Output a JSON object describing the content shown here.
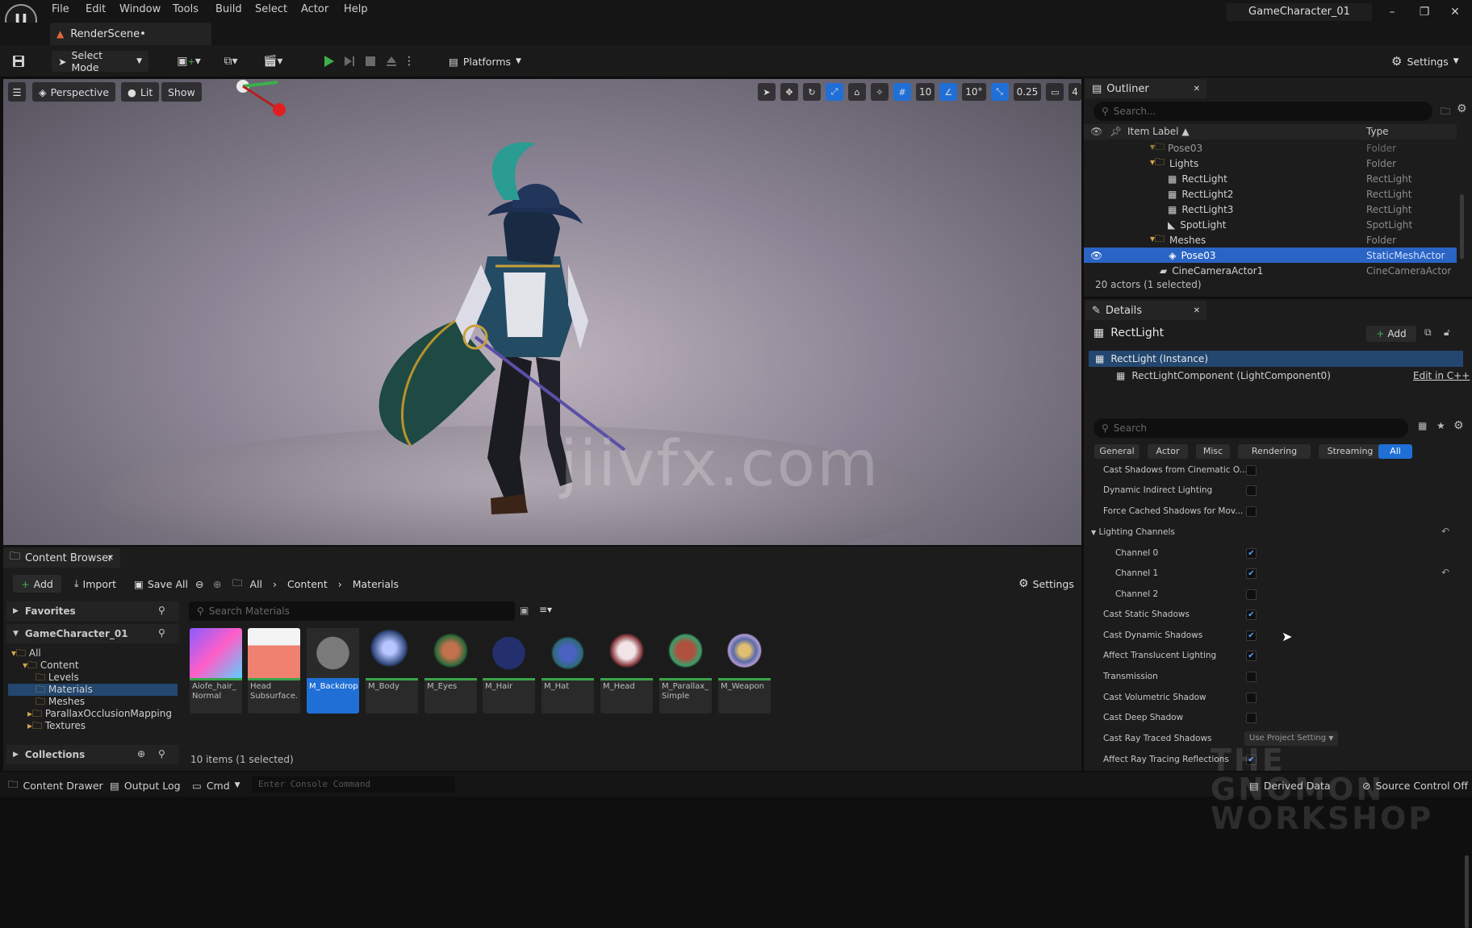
{
  "menubar": {
    "items": [
      "File",
      "Edit",
      "Window",
      "Tools",
      "Build",
      "Select",
      "Actor",
      "Help"
    ],
    "project_name": "GameCharacter_01"
  },
  "doc_tab": {
    "label": "RenderScene•"
  },
  "toolbar": {
    "select_mode": "Select Mode",
    "platforms": "Platforms",
    "settings": "Settings"
  },
  "viewport": {
    "perspective": "Perspective",
    "lit": "Lit",
    "show": "Show",
    "grid_size": "10",
    "rotation_snap": "10°",
    "scale_snap": "0.25",
    "camera_speed": "4",
    "watermark": "jiivfx.com"
  },
  "outliner": {
    "tab": "Outliner",
    "search_placeholder": "Search...",
    "col_label": "Item Label ▲",
    "col_type": "Type",
    "rows": [
      {
        "label": "Pose03",
        "type": "Folder"
      },
      {
        "label": "Lights",
        "type": "Folder"
      },
      {
        "label": "RectLight",
        "type": "RectLight"
      },
      {
        "label": "RectLight2",
        "type": "RectLight"
      },
      {
        "label": "RectLight3",
        "type": "RectLight"
      },
      {
        "label": "SpotLight",
        "type": "SpotLight"
      },
      {
        "label": "Meshes",
        "type": "Folder"
      },
      {
        "label": "Pose03",
        "type": "StaticMeshActor"
      },
      {
        "label": "CineCameraActor1",
        "type": "CineCameraActor"
      }
    ],
    "status": "20 actors (1 selected)"
  },
  "details": {
    "tab": "Details",
    "actor": "RectLight",
    "add": "Add",
    "instance": "RectLight (Instance)",
    "component": "RectLightComponent (LightComponent0)",
    "edit_cpp": "Edit in C++",
    "search_placeholder": "Search",
    "tabs": [
      "General",
      "Actor",
      "Misc",
      "Rendering",
      "Streaming",
      "All"
    ],
    "props": [
      {
        "label": "Cast Shadows from Cinematic O...",
        "checked": false
      },
      {
        "label": "Dynamic Indirect Lighting",
        "checked": false
      },
      {
        "label": "Force Cached Shadows for Mov...",
        "checked": false
      },
      {
        "label": "Lighting Channels",
        "section": true
      },
      {
        "label": "Channel 0",
        "checked": true
      },
      {
        "label": "Channel 1",
        "checked": true
      },
      {
        "label": "Channel 2",
        "checked": false
      },
      {
        "label": "Cast Static Shadows",
        "checked": true
      },
      {
        "label": "Cast Dynamic Shadows",
        "checked": true
      },
      {
        "label": "Affect Translucent Lighting",
        "checked": true
      },
      {
        "label": "Transmission",
        "checked": false
      },
      {
        "label": "Cast Volumetric Shadow",
        "checked": false
      },
      {
        "label": "Cast Deep Shadow",
        "checked": false
      },
      {
        "label": "Cast Ray Traced Shadows",
        "dropdown": "Use Project Setting"
      },
      {
        "label": "Affect Ray Tracing Reflections",
        "checked": true
      }
    ]
  },
  "content_browser": {
    "tab": "Content Browser",
    "add": "Add",
    "import": "Import",
    "save_all": "Save All",
    "breadcrumb": [
      "All",
      "Content",
      "Materials"
    ],
    "settings": "Settings",
    "favorites": "Favorites",
    "root": "GameCharacter_01",
    "tree": [
      "All",
      "Content",
      "Levels",
      "Materials",
      "Meshes",
      "ParallaxOcclusionMapping",
      "Textures"
    ],
    "collections": "Collections",
    "search_placeholder": "Search Materials",
    "assets": [
      {
        "label": "Aiofe_hair_ Normal"
      },
      {
        "label": "Head Subsurface..."
      },
      {
        "label": "M_Backdrop"
      },
      {
        "label": "M_Body"
      },
      {
        "label": "M_Eyes"
      },
      {
        "label": "M_Hair"
      },
      {
        "label": "M_Hat"
      },
      {
        "label": "M_Head"
      },
      {
        "label": "M_Parallax_ Simple"
      },
      {
        "label": "M_Weapon"
      }
    ],
    "item_count": "10 items (1 selected)"
  },
  "statusbar": {
    "content_drawer": "Content Drawer",
    "output_log": "Output Log",
    "cmd": "Cmd",
    "console_placeholder": "Enter Console Command",
    "derived_data": "Derived Data",
    "source_control": "Source Control Off",
    "gnomon": "THE GNOMON WORKSHOP"
  },
  "colors": {
    "accent": "#1f6fd6",
    "selection": "#2a64c4",
    "play": "#3bb04a"
  }
}
